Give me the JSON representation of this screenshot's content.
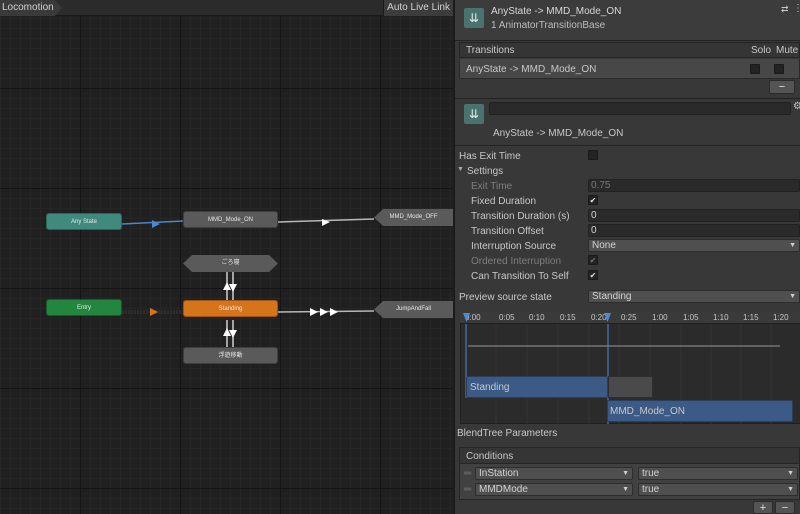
{
  "graph": {
    "breadcrumb": "Locomotion",
    "auto_live_link": "Auto Live Link",
    "nodes": {
      "any_state": "Any State",
      "mmd_on": "MMD_Mode_ON",
      "mmd_off": "MMD_Mode_OFF",
      "gorone": "ごろ寝",
      "entry": "Entry",
      "standing": "Standing",
      "jump": "JumpAndFall",
      "floating": "浮遊移動"
    }
  },
  "inspector": {
    "header_title": "AnyState -> MMD_Mode_ON",
    "header_subtitle": "1 AnimatorTransitionBase",
    "transitions_label": "Transitions",
    "solo_label": "Solo",
    "mute_label": "Mute",
    "transition_row": "AnyState -> MMD_Mode_ON",
    "minus": "−",
    "name_value": "",
    "sub_title": "AnyState -> MMD_Mode_ON",
    "has_exit_time": "Has Exit Time",
    "settings_label": "Settings",
    "exit_time_label": "Exit Time",
    "exit_time_value": "0.75",
    "fixed_duration_label": "Fixed Duration",
    "transition_duration_label": "Transition Duration (s)",
    "transition_duration_value": "0",
    "transition_offset_label": "Transition Offset",
    "transition_offset_value": "0",
    "interruption_source_label": "Interruption Source",
    "interruption_source_value": "None",
    "ordered_interruption_label": "Ordered Interruption",
    "can_transition_label": "Can Transition To Self",
    "preview_label": "Preview source state",
    "preview_value": "Standing",
    "ticks": [
      "0:00",
      "0:05",
      "0:10",
      "0:15",
      "0:20",
      "0:25",
      "1:00",
      "1:05",
      "1:10",
      "1:15",
      "1:20"
    ],
    "clip_source": "Standing",
    "clip_dest": "MMD_Mode_ON",
    "blendtree_label": "BlendTree Parameters",
    "conditions_label": "Conditions",
    "conditions": [
      {
        "param": "InStation",
        "value": "true"
      },
      {
        "param": "MMDMode",
        "value": "true"
      }
    ],
    "plus": "+",
    "minus2": "−"
  },
  "colors": {
    "any_state": "#3f8a7c",
    "entry": "#23863e",
    "standing": "#d6741c",
    "clip_bar": "#3b5a86",
    "playhead": "#4c8ad6"
  },
  "icons": [
    "transition-icon",
    "settings-icon",
    "gear-icon",
    "link-icon",
    "more-icon"
  ]
}
